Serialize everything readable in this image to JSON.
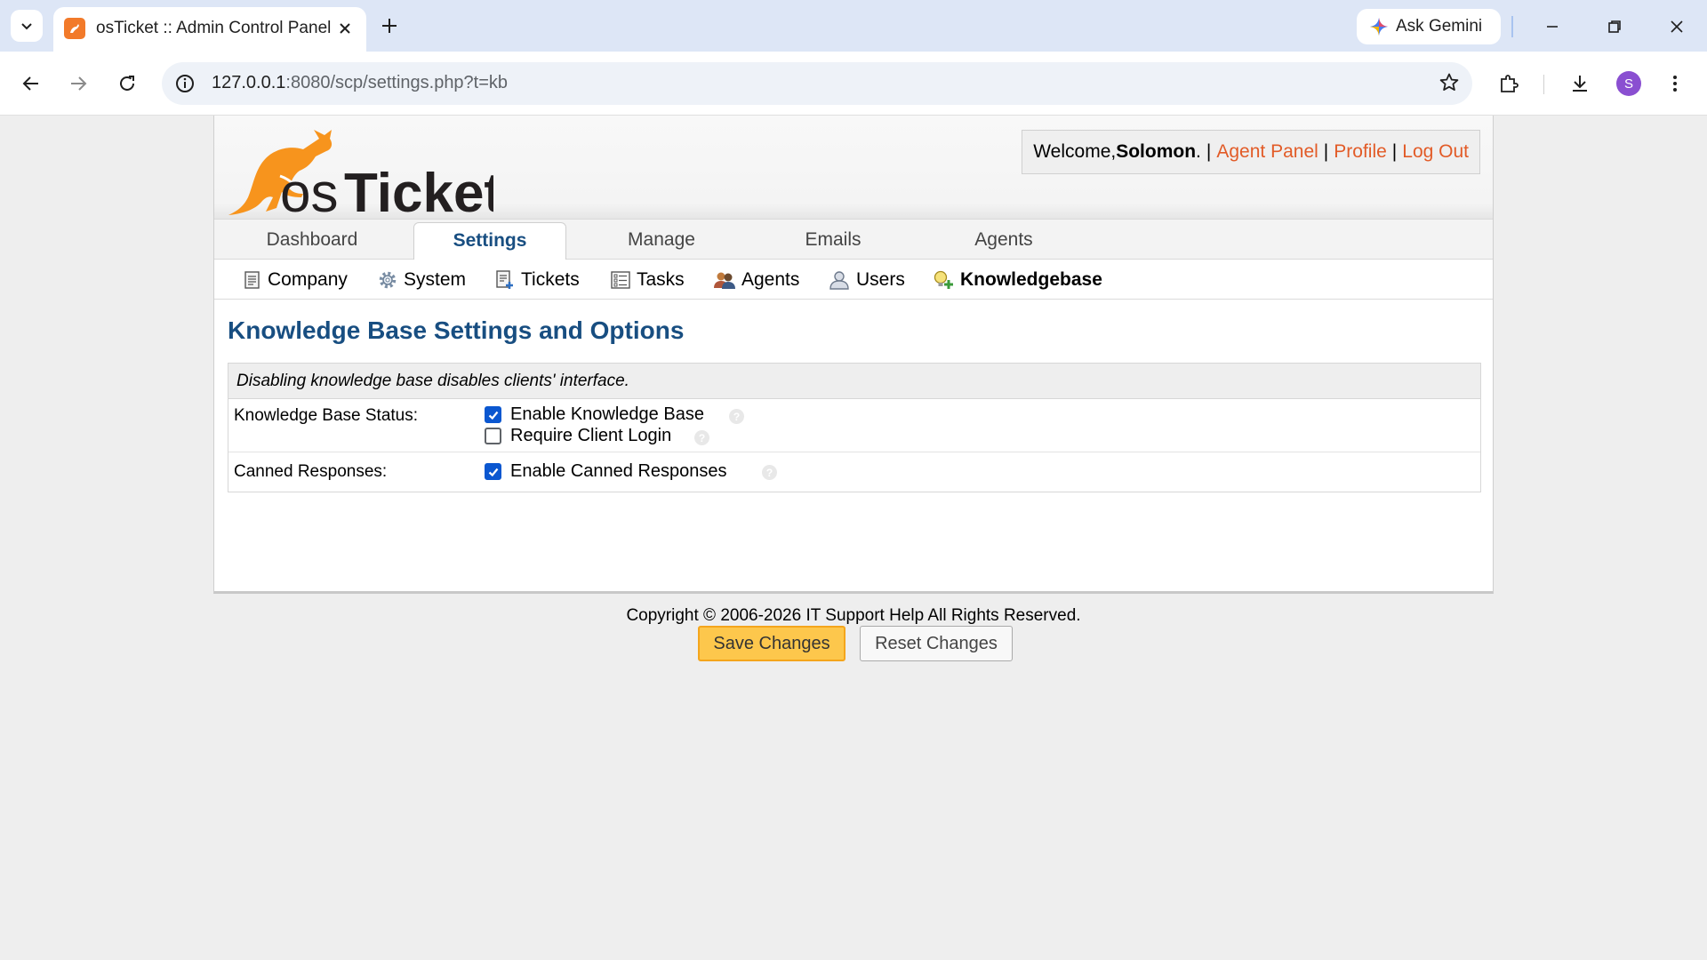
{
  "browser": {
    "tab_title": "osTicket :: Admin Control Panel",
    "gemini_label": "Ask Gemini",
    "url_host": "127.0.0.1",
    "url_path": ":8080/scp/settings.php?t=kb",
    "profile_initial": "S",
    "accent_color": "#0b57d0"
  },
  "header": {
    "logo_text": "osTicket",
    "welcome_prefix": "Welcome, ",
    "user_name": "Solomon",
    "welcome_suffix": ".",
    "links": {
      "agent_panel": "Agent Panel",
      "profile": "Profile",
      "logout": "Log Out"
    },
    "separator": "|"
  },
  "main_nav": {
    "items": [
      {
        "label": "Dashboard",
        "active": false
      },
      {
        "label": "Settings",
        "active": true
      },
      {
        "label": "Manage",
        "active": false
      },
      {
        "label": "Emails",
        "active": false
      },
      {
        "label": "Agents",
        "active": false
      }
    ]
  },
  "sub_nav": {
    "items": [
      {
        "label": "Company",
        "icon": "company-icon"
      },
      {
        "label": "System",
        "icon": "gear-icon"
      },
      {
        "label": "Tickets",
        "icon": "tickets-icon"
      },
      {
        "label": "Tasks",
        "icon": "tasks-icon"
      },
      {
        "label": "Agents",
        "icon": "agents-icon"
      },
      {
        "label": "Users",
        "icon": "users-icon"
      },
      {
        "label": "Knowledgebase",
        "icon": "knowledgebase-icon",
        "active": true
      }
    ]
  },
  "content": {
    "title": "Knowledge Base Settings and Options",
    "note": "Disabling knowledge base disables clients' interface.",
    "rows": {
      "status": {
        "label": "Knowledge Base Status:",
        "options": [
          {
            "label": "Enable Knowledge Base",
            "checked": true
          },
          {
            "label": "Require Client Login",
            "checked": false
          }
        ]
      },
      "canned": {
        "label": "Canned Responses:",
        "options": [
          {
            "label": "Enable Canned Responses",
            "checked": true
          }
        ]
      }
    },
    "buttons": {
      "save": "Save Changes",
      "reset": "Reset Changes"
    }
  },
  "footer": {
    "copyright": "Copyright © 2006-2026 IT Support Help All Rights Reserved."
  }
}
